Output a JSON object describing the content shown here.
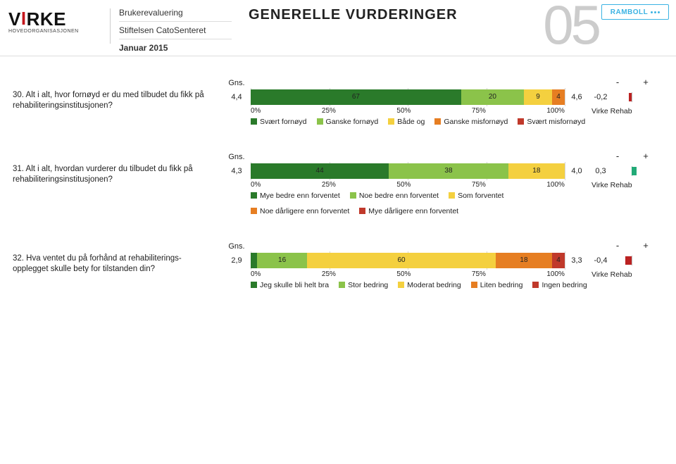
{
  "header": {
    "brand_name": "VIRKE",
    "brand_sub": "HOVEDORGANISASJONEN",
    "meta1": "Brukerevaluering",
    "meta2": "Stiftelsen CatoSenteret",
    "meta3": "Januar 2015",
    "page_title": "GENERELLE VURDERINGER",
    "page_number": "05",
    "partner": "RAMBOLL"
  },
  "labels": {
    "gns": "Gns.",
    "minus": "-",
    "plus": "+",
    "virke_rehab": "Virke Rehab",
    "axis": [
      "0%",
      "25%",
      "50%",
      "75%",
      "100%"
    ]
  },
  "chart_data": [
    {
      "type": "bar",
      "question": "30. Alt i alt, hvor fornøyd er du med tilbudet du fikk på rehabiliteringsinstitusjonen?",
      "gns": "4,4",
      "comparison_value": "4,6",
      "diff": "-0,2",
      "diff_numeric": -0.2,
      "categories": [
        "Svært fornøyd",
        "Ganske fornøyd",
        "Både og",
        "Ganske misfornøyd",
        "Svært misfornøyd"
      ],
      "values": [
        67,
        20,
        9,
        4,
        0
      ],
      "colors": [
        "c-darkgreen",
        "c-green",
        "c-yellow",
        "c-orange",
        "c-red"
      ]
    },
    {
      "type": "bar",
      "question": "31. Alt i alt, hvordan vurderer du tilbudet du fikk på rehabiliteringsinstitusjonen?",
      "gns": "4,3",
      "comparison_value": "4,0",
      "diff": "0,3",
      "diff_numeric": 0.3,
      "categories": [
        "Mye bedre enn forventet",
        "Noe bedre enn forventet",
        "Som forventet",
        "Noe dårligere enn forventet",
        "Mye dårligere enn forventet"
      ],
      "values": [
        44,
        38,
        18,
        0,
        0
      ],
      "colors": [
        "c-darkgreen",
        "c-green",
        "c-yellow",
        "c-orange",
        "c-red"
      ]
    },
    {
      "type": "bar",
      "question": "32. Hva ventet du på forhånd at rehabiliterings-opplegget skulle bety for tilstanden din?",
      "gns": "2,9",
      "comparison_value": "3,3",
      "diff": "-0,4",
      "diff_numeric": -0.4,
      "categories": [
        "Jeg skulle bli helt bra",
        "Stor bedring",
        "Moderat bedring",
        "Liten bedring",
        "Ingen bedring"
      ],
      "values": [
        2,
        16,
        60,
        18,
        4
      ],
      "colors": [
        "c-darkgreen",
        "c-green",
        "c-yellow",
        "c-orange",
        "c-red"
      ]
    }
  ]
}
